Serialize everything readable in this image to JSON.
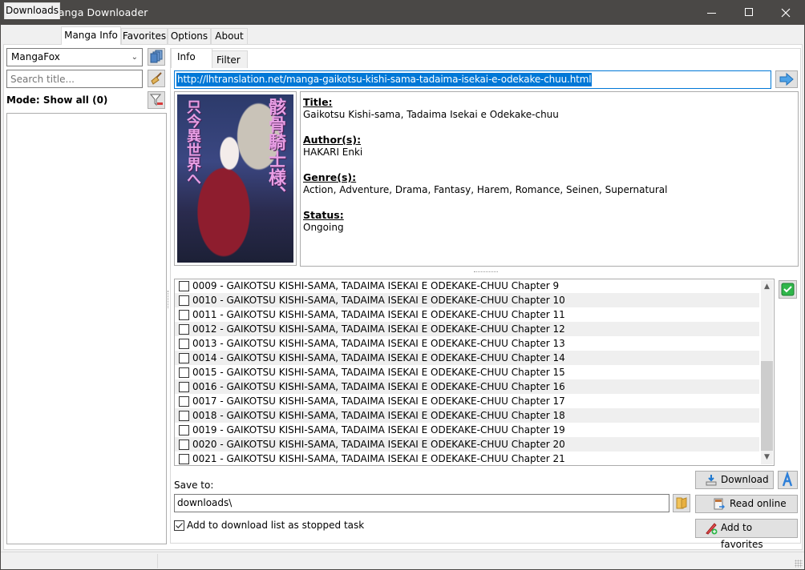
{
  "window": {
    "title": "Free Manga Downloader"
  },
  "main_tabs": [
    {
      "label": "Downloads",
      "active": false
    },
    {
      "label": "Manga Info",
      "active": true
    },
    {
      "label": "Favorites",
      "active": false
    },
    {
      "label": "Options",
      "active": false
    },
    {
      "label": "About",
      "active": false
    }
  ],
  "left_panel": {
    "source_select": {
      "value": "MangaFox"
    },
    "search": {
      "placeholder": "Search title...",
      "value": ""
    },
    "mode_label": "Mode: Show all (0)",
    "icons": {
      "website_list": "stacked-pages-icon",
      "clear_search": "broom-icon",
      "filter": "filter-remove-icon"
    }
  },
  "sub_tabs": [
    {
      "label": "Info",
      "active": true
    },
    {
      "label": "Filter",
      "active": false
    }
  ],
  "url_bar": {
    "value": "http://lhtranslation.net/manga-gaikotsu-kishi-sama-tadaima-isekai-e-odekake-chuu.html",
    "go_icon": "arrow-right-icon"
  },
  "cover": {
    "title_jp_right": "骸骨騎士様、",
    "title_jp_left": "只今異世界へ",
    "alt": "manga cover art"
  },
  "info": {
    "title_label": "Title:",
    "title_value": "Gaikotsu Kishi-sama, Tadaima Isekai e Odekake-chuu",
    "author_label": "Author(s):",
    "author_value": "HAKARI Enki",
    "genre_label": "Genre(s):",
    "genre_value": "Action, Adventure, Drama, Fantasy, Harem, Romance, Seinen, Supernatural",
    "status_label": "Status:",
    "status_value": "Ongoing"
  },
  "chapters": [
    {
      "label": "0009 - GAIKOTSU KISHI-SAMA, TADAIMA ISEKAI E ODEKAKE-CHUU Chapter 9",
      "checked": false
    },
    {
      "label": "0010 - GAIKOTSU KISHI-SAMA, TADAIMA ISEKAI E ODEKAKE-CHUU Chapter 10",
      "checked": false
    },
    {
      "label": "0011 - GAIKOTSU KISHI-SAMA, TADAIMA ISEKAI E ODEKAKE-CHUU Chapter 11",
      "checked": false
    },
    {
      "label": "0012 - GAIKOTSU KISHI-SAMA, TADAIMA ISEKAI E ODEKAKE-CHUU Chapter 12",
      "checked": false
    },
    {
      "label": "0013 - GAIKOTSU KISHI-SAMA, TADAIMA ISEKAI E ODEKAKE-CHUU Chapter 13",
      "checked": false
    },
    {
      "label": "0014 - GAIKOTSU KISHI-SAMA, TADAIMA ISEKAI E ODEKAKE-CHUU Chapter 14",
      "checked": false
    },
    {
      "label": "0015 - GAIKOTSU KISHI-SAMA, TADAIMA ISEKAI E ODEKAKE-CHUU Chapter 15",
      "checked": false
    },
    {
      "label": "0016 - GAIKOTSU KISHI-SAMA, TADAIMA ISEKAI E ODEKAKE-CHUU Chapter 16",
      "checked": false
    },
    {
      "label": "0017 - GAIKOTSU KISHI-SAMA, TADAIMA ISEKAI E ODEKAKE-CHUU Chapter 17",
      "checked": false
    },
    {
      "label": "0018 - GAIKOTSU KISHI-SAMA, TADAIMA ISEKAI E ODEKAKE-CHUU Chapter 18",
      "checked": false
    },
    {
      "label": "0019 - GAIKOTSU KISHI-SAMA, TADAIMA ISEKAI E ODEKAKE-CHUU Chapter 19",
      "checked": false
    },
    {
      "label": "0020 - GAIKOTSU KISHI-SAMA, TADAIMA ISEKAI E ODEKAKE-CHUU Chapter 20",
      "checked": false
    },
    {
      "label": "0021 - GAIKOTSU KISHI-SAMA, TADAIMA ISEKAI E ODEKAKE-CHUU Chapter 21",
      "checked": false
    }
  ],
  "chapter_scroll": {
    "thumb_start_fraction": 0.43,
    "thumb_end_fraction": 1.0
  },
  "check_all_icon": "green-check-icon",
  "save": {
    "label": "Save to:",
    "value": "downloads\\",
    "folder_icon": "folder-icon"
  },
  "stopped_task": {
    "label": "Add to download list as stopped task",
    "checked": true
  },
  "buttons": {
    "download": "Download",
    "read_online": "Read online",
    "add_favorites": "Add to favorites",
    "az_icon": "sort-az-icon"
  },
  "colors": {
    "titlebar": "#4a4846",
    "selection": "#0078d7",
    "alt_row": "#efefef",
    "button_face": "#e1e1e1"
  }
}
